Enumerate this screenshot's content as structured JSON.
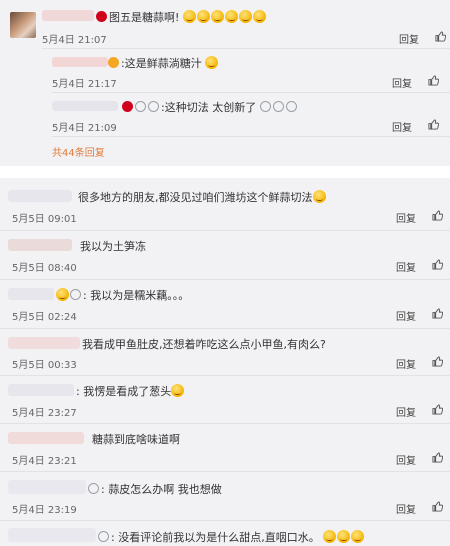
{
  "thread": {
    "main": {
      "text": "图五是糖蒜啊!",
      "time": "5月4日 21:07",
      "reply": "回复"
    },
    "sub1": {
      "text": ":这是鲜蒜淌糖汁",
      "time": "5月4日 21:17",
      "reply": "回复"
    },
    "sub2": {
      "text": ":这种切法 太创新了",
      "time": "5月4日 21:09",
      "reply": "回复"
    },
    "more": "共44条回复"
  },
  "comments": [
    {
      "text": "很多地方的朋友,都没见过咱们潍坊这个鲜蒜切法",
      "time": "5月5日 09:01",
      "reply": "回复"
    },
    {
      "text": "我以为土笋冻",
      "time": "5月5日 08:40",
      "reply": "回复"
    },
    {
      "text": ": 我以为是糯米藕。。。",
      "time": "5月5日 02:24",
      "reply": "回复"
    },
    {
      "text": "我看成甲鱼肚皮,还想着咋吃这么点小甲鱼,有肉么?",
      "time": "5月5日 00:33",
      "reply": "回复"
    },
    {
      "text": ": 我愣是看成了葱头",
      "time": "5月4日 23:27",
      "reply": "回复"
    },
    {
      "text": "糖蒜到底啥味道啊",
      "time": "5月4日 23:21",
      "reply": "回复"
    },
    {
      "text": ": 蒜皮怎么办啊 我也想做",
      "time": "5月4日 23:19",
      "reply": "回复"
    },
    {
      "text": ": 没看评论前我以为是什么甜点,直咽口水。",
      "time": "",
      "reply": ""
    }
  ],
  "colors": {
    "panel": "#f2f2f5",
    "link": "#e07b39",
    "text": "#333333"
  }
}
